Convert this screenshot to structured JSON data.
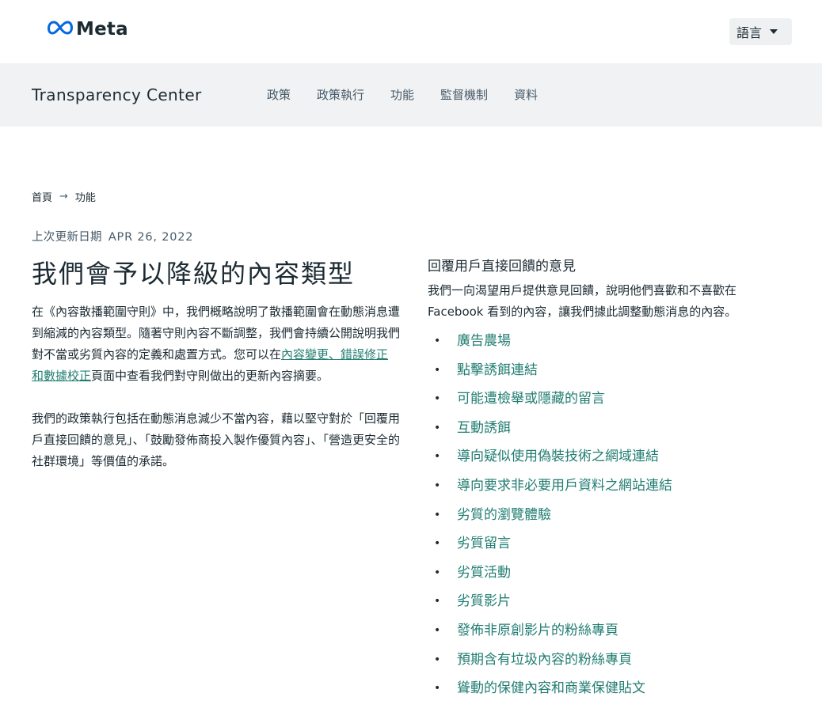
{
  "header": {
    "logo_text": "Meta",
    "language_label": "語言"
  },
  "navbar": {
    "brand": "Transparency Center",
    "items": [
      "政策",
      "政策執行",
      "功能",
      "監督機制",
      "資料"
    ]
  },
  "breadcrumb": {
    "home": "首頁",
    "current": "功能"
  },
  "updated": {
    "label": "上次更新日期",
    "date": "APR 26, 2022"
  },
  "left": {
    "title": "我們會予以降級的內容類型",
    "para1_before": "在《內容散播範圍守則》中，我們概略說明了散播範圍會在動態消息遭到縮減的內容類型。隨著守則內容不斷調整，我們會持續公開說明我們對不當或劣質內容的定義和處置方式。您可以在",
    "para1_link": "內容變更、錯誤修正和數據校正",
    "para1_after": "頁面中查看我們對守則做出的更新內容摘要。",
    "para2": "我們的政策執行包括在動態消息減少不當內容，藉以堅守對於「回覆用戶直接回饋的意見」、「鼓勵發佈商投入製作優質內容」、「營造更安全的社群環境」等價值的承諾。"
  },
  "right": {
    "subhead": "回覆用戶直接回饋的意見",
    "para": "我們一向渴望用戶提供意見回饋，說明他們喜歡和不喜歡在 Facebook 看到的內容，讓我們據此調整動態消息的內容。",
    "items": [
      "廣告農場",
      "點擊誘餌連結",
      "可能遭檢舉或隱藏的留言",
      "互動誘餌",
      "導向疑似使用偽裝技術之網域連結",
      "導向要求非必要用戶資料之網站連結",
      "劣質的瀏覽體驗",
      "劣質留言",
      "劣質活動",
      "劣質影片",
      "發佈非原創影片的粉絲專頁",
      "預期含有垃圾內容的粉絲專頁",
      "聳動的保健內容和商業保健貼文"
    ]
  }
}
